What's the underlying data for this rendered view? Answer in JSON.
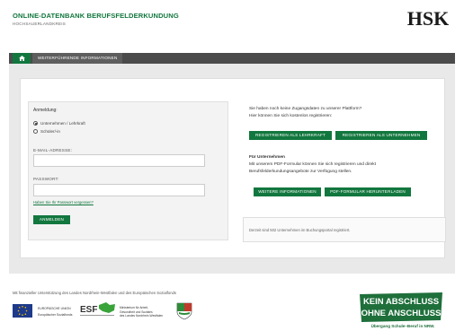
{
  "header": {
    "title": "ONLINE-DATENBANK BERUFSFELDERKUNDUNG",
    "subtitle": "HOCHSAUERLANDKREIS",
    "logo_text": "HSK"
  },
  "nav": {
    "home_icon": "home-icon",
    "items": [
      {
        "label": "WEITERFÜHRENDE INFORMATIONEN"
      }
    ]
  },
  "login": {
    "title": "Anmeldung:",
    "options": [
      {
        "label": "Unternehmen / Lehrkraft",
        "checked": true
      },
      {
        "label": "Schüler/-in",
        "checked": false
      }
    ],
    "email_label": "E-MAIL-ADRESSE:",
    "email_value": "",
    "password_label": "PASSWORT:",
    "password_value": "",
    "forgot_link": "Haben Sie Ihr Passwort vergessen?",
    "submit_label": "ANMELDEN"
  },
  "register": {
    "line1": "Sie haben noch keine Zugangsdaten zu unserer Plattform?",
    "line2": "Hier können Sie sich kostenlos registrieren:",
    "btn_teacher": "REGISTRIEREN ALS LEHRKRAFT",
    "btn_company": "REGISTRIEREN ALS UNTERNEHMEN"
  },
  "companies": {
    "heading": "Für Unternehmen",
    "line1": "Mit unserem PDF-Formular können Sie sich registrieren und direkt",
    "line2": "Berufsfelderkundungsangebote zur Verfügung stellen.",
    "btn_info": "WEITERE INFORMATIONEN",
    "btn_pdf": "PDF-FORMULAR HERUNTERLADEN"
  },
  "stats": {
    "text": "Derzeit sind 502 Unternehmen im Buchungsportal registriert."
  },
  "footer": {
    "support_text": "Mit finanzieller Unterstützung des Landes Nordrhein-Westfalen und des Europäischen Sozialfonds",
    "eu_line1": "EUROPÄISCHE UNION",
    "eu_line2": "Europäischer Sozialfonds",
    "esf_text": "ESF",
    "ministry_line1": "Ministerium für Arbeit,",
    "ministry_line2": "Gesundheit und Soziales",
    "ministry_line3": "des Landes Nordrhein-Westfalen",
    "kas_line1": "KEIN ABSCHLUSS",
    "kas_line2": "OHNE ANSCHLUSS",
    "kas_line3": "Übergang Schule–Beruf in NRW."
  },
  "colors": {
    "brand_green": "#12773e",
    "nav_dark": "#4b4b4b"
  }
}
